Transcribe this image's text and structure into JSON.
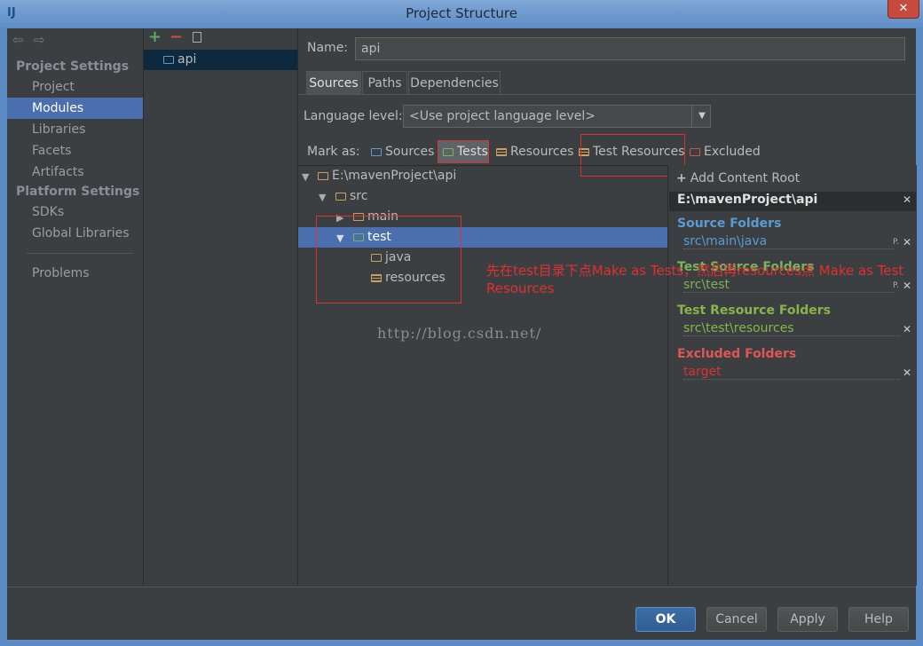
{
  "window": {
    "title": "Project Structure",
    "app_icon": "IJ",
    "close": "✕"
  },
  "nav": {
    "back_icon": "back-arrow-icon",
    "forward_icon": "forward-arrow-icon",
    "project_settings": "Project Settings",
    "project_items": [
      "Project",
      "Modules",
      "Libraries",
      "Facets",
      "Artifacts"
    ],
    "platform_settings": "Platform Settings",
    "platform_items": [
      "SDKs",
      "Global Libraries"
    ],
    "problems": "Problems",
    "selected": "Modules"
  },
  "modules": {
    "items": [
      "api"
    ],
    "add": "+",
    "remove": "−"
  },
  "main": {
    "name_label": "Name:",
    "name_value": "api",
    "tabs": [
      "Sources",
      "Paths",
      "Dependencies"
    ],
    "active_tab": "Sources",
    "language_label": "Language level:",
    "language_value": "<Use project language level>",
    "mark_as_label": "Mark as:",
    "mark_buttons": [
      "Sources",
      "Tests",
      "Resources",
      "Test Resources",
      "Excluded"
    ]
  },
  "tree": {
    "root": "E:\\mavenProject\\api",
    "src": "src",
    "main": "main",
    "test": "test",
    "java": "java",
    "resources": "resources"
  },
  "annotation": {
    "line1": "先在test目录下点Make as Tests，然后再resources点 Make as Test",
    "line2": "Resources",
    "watermark": "http://blog.csdn.net/"
  },
  "right": {
    "add_root": "Add Content Root",
    "root_path": "E:\\mavenProject\\api",
    "source_folders": {
      "title": "Source Folders",
      "path": "src\\main\\java"
    },
    "test_source_folders": {
      "title": "Test Source Folders",
      "path": "src\\test"
    },
    "test_resource_folders": {
      "title": "Test Resource Folders",
      "path": "src\\test\\resources"
    },
    "excluded_folders": {
      "title": "Excluded Folders",
      "path": "target"
    }
  },
  "buttons": {
    "ok": "OK",
    "cancel": "Cancel",
    "apply": "Apply",
    "help": "Help"
  },
  "colors": {
    "selection": "#4b6eaf",
    "source": "#5a9bd4",
    "test": "#79b35a",
    "test_resource": "#8ab34a",
    "excluded": "#e05555",
    "annotation": "#e03030"
  }
}
